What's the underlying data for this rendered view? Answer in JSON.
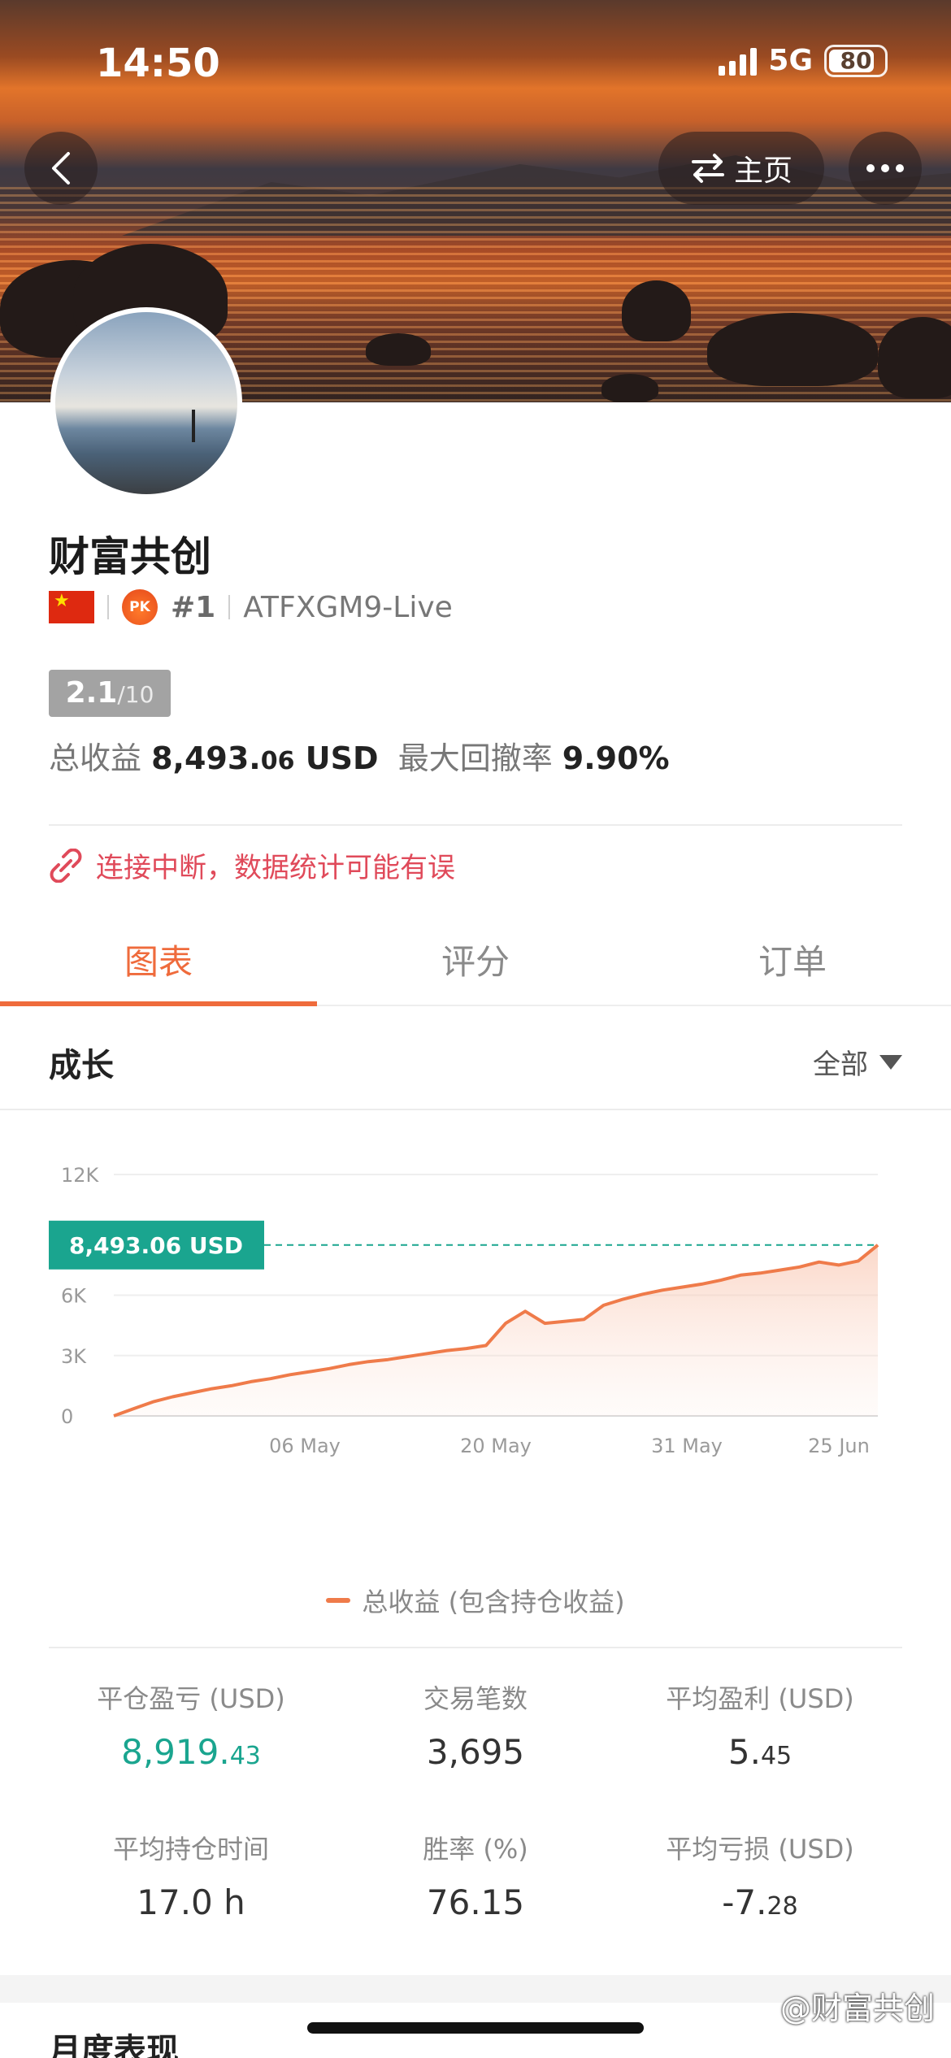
{
  "status_bar": {
    "time": "14:50",
    "network": "5G",
    "battery": "80"
  },
  "header": {
    "home_label": "主页",
    "back_icon": "chevron-left-icon",
    "more_icon": "more-dots-icon"
  },
  "profile": {
    "name": "财富共创",
    "rank": "#1",
    "account": "ATFXGM9-Live",
    "score": "2.1",
    "score_max": "/10",
    "total_profit_label": "总收益",
    "total_profit_int": "8,493.",
    "total_profit_dec": "06",
    "total_profit_unit": "USD",
    "max_drawdown_label": "最大回撤率",
    "max_drawdown": "9.90%"
  },
  "warning": "连接中断，数据统计可能有误",
  "tabs": [
    {
      "label": "图表",
      "active": true
    },
    {
      "label": "评分",
      "active": false
    },
    {
      "label": "订单",
      "active": false
    }
  ],
  "growth": {
    "title": "成长",
    "range": "全部"
  },
  "chart_data": {
    "type": "area",
    "title": "",
    "ylabel": "",
    "xlabel": "",
    "y_ticks": [
      "12K",
      "6K",
      "3K",
      "0"
    ],
    "ylim": [
      0,
      12000
    ],
    "x_tick_labels": [
      "06 May",
      "20 May",
      "31 May",
      "25 Jun"
    ],
    "current_value_label": "8,493.06 USD",
    "current_value": 8493.06,
    "series": [
      {
        "name": "总收益 (包含持仓收益)",
        "color": "#ef7b4a",
        "values": [
          0,
          350,
          700,
          950,
          1150,
          1350,
          1500,
          1700,
          1850,
          2050,
          2200,
          2350,
          2550,
          2700,
          2800,
          2950,
          3100,
          3250,
          3350,
          3500,
          4600,
          5200,
          4600,
          4700,
          4800,
          5500,
          5800,
          6050,
          6250,
          6400,
          6550,
          6750,
          7000,
          7100,
          7250,
          7400,
          7650,
          7500,
          7700,
          8493.06
        ]
      }
    ]
  },
  "legend_label": "总收益 (包含持仓收益)",
  "stats": [
    {
      "label": "平仓盈亏 (USD)",
      "int": "8,919.",
      "dec": "43",
      "green": true
    },
    {
      "label": "交易笔数",
      "int": "3,695",
      "dec": "",
      "green": false
    },
    {
      "label": "平均盈利 (USD)",
      "int": "5.",
      "dec": "45",
      "green": false
    },
    {
      "label": "平均持仓时间",
      "int": "17.0 h",
      "dec": "",
      "green": false
    },
    {
      "label": "胜率 (%)",
      "int": "76.15",
      "dec": "",
      "green": false
    },
    {
      "label": "平均亏损 (USD)",
      "int": "-7.",
      "dec": "28",
      "green": false
    }
  ],
  "monthly_title": "月度表现",
  "watermark": "@财富共创"
}
